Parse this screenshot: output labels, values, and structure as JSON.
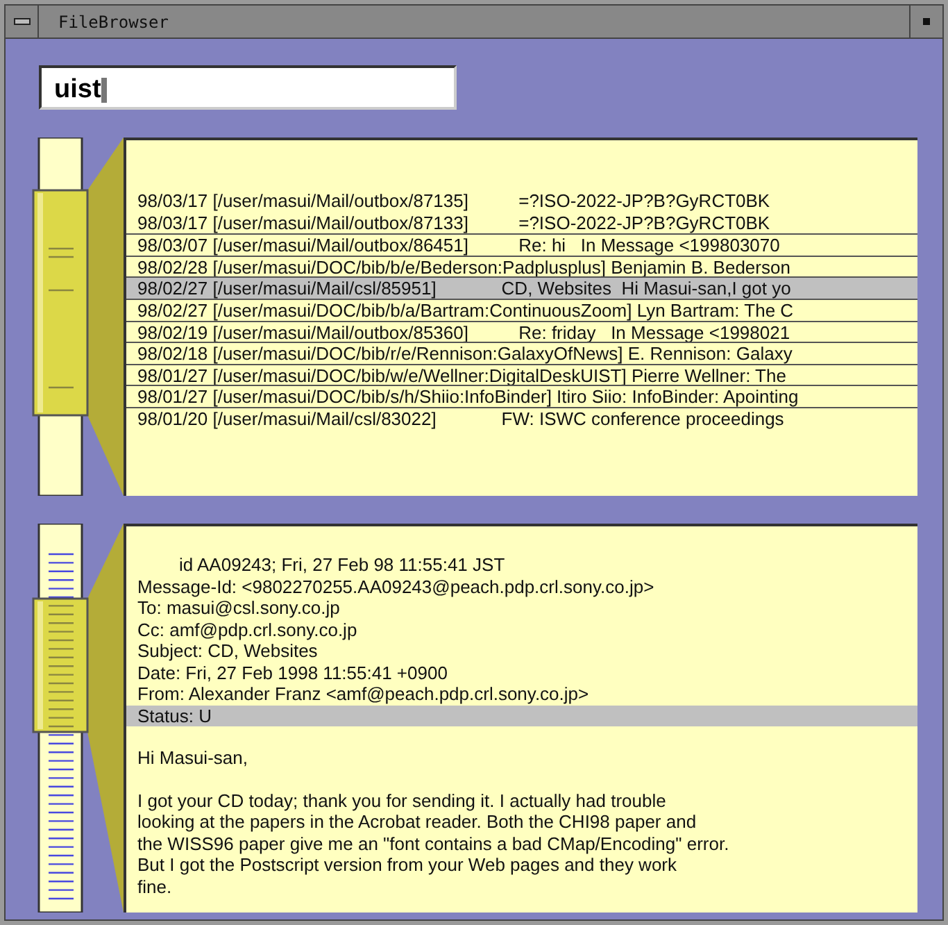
{
  "window": {
    "title": "FileBrowser"
  },
  "search": {
    "value": "uist"
  },
  "results": [
    {
      "text": "98/03/17 [/user/masui/Mail/outbox/87135]          =?ISO-2022-JP?B?GyRCT0BK",
      "selected": false,
      "ruled": false
    },
    {
      "text": "98/03/17 [/user/masui/Mail/outbox/87133]          =?ISO-2022-JP?B?GyRCT0BK",
      "selected": false,
      "ruled": false
    },
    {
      "text": "98/03/07 [/user/masui/Mail/outbox/86451]          Re: hi   In Message <199803070",
      "selected": false,
      "ruled": true
    },
    {
      "text": "98/02/28 [/user/masui/DOC/bib/b/e/Bederson:Padplusplus] Benjamin B. Bederson",
      "selected": false,
      "ruled": true
    },
    {
      "text": "98/02/27 [/user/masui/Mail/csl/85951]             CD, Websites  Hi Masui-san,I got yo",
      "selected": true,
      "ruled": true
    },
    {
      "text": "98/02/27 [/user/masui/DOC/bib/b/a/Bartram:ContinuousZoom] Lyn Bartram: The C",
      "selected": false,
      "ruled": true
    },
    {
      "text": "98/02/19 [/user/masui/Mail/outbox/85360]          Re: friday   In Message <1998021",
      "selected": false,
      "ruled": true
    },
    {
      "text": "98/02/18 [/user/masui/DOC/bib/r/e/Rennison:GalaxyOfNews] E. Rennison: Galaxy",
      "selected": false,
      "ruled": true
    },
    {
      "text": "98/01/27 [/user/masui/DOC/bib/w/e/Wellner:DigitalDeskUIST] Pierre Wellner: The",
      "selected": false,
      "ruled": true
    },
    {
      "text": "98/01/27 [/user/masui/DOC/bib/s/h/Shiio:InfoBinder] Itiro Siio: InfoBinder: Apointing",
      "selected": false,
      "ruled": true
    },
    {
      "text": "98/01/20 [/user/masui/Mail/csl/83022]             FW: ISWC conference proceedings",
      "selected": false,
      "ruled": true
    }
  ],
  "message": {
    "headers": [
      {
        "text": "id AA09243; Fri, 27 Feb 98 11:55:41 JST",
        "kind": "continuation",
        "selected": false
      },
      {
        "text": "Message-Id: <9802270255.AA09243@peach.pdp.crl.sony.co.jp>",
        "kind": "field",
        "selected": false
      },
      {
        "text": "To: masui@csl.sony.co.jp",
        "kind": "field",
        "selected": false
      },
      {
        "text": "Cc: amf@pdp.crl.sony.co.jp",
        "kind": "field",
        "selected": false
      },
      {
        "text": "Subject: CD, Websites",
        "kind": "field",
        "selected": false
      },
      {
        "text": "Date: Fri, 27 Feb 1998 11:55:41 +0900",
        "kind": "field",
        "selected": false
      },
      {
        "text": "From: Alexander Franz <amf@peach.pdp.crl.sony.co.jp>",
        "kind": "field",
        "selected": false
      },
      {
        "text": "Status: U",
        "kind": "field",
        "selected": true
      }
    ],
    "greeting": "Hi Masui-san,",
    "body": "I got your CD today; thank you for sending it. I actually had trouble\nlooking at the papers in the Acrobat reader. Both the CHI98 paper and\nthe WISS96 paper give me an \"font contains a bad CMap/Encoding\" error.\nBut I got the Postscript version from your Web pages and they work\nfine."
  }
}
